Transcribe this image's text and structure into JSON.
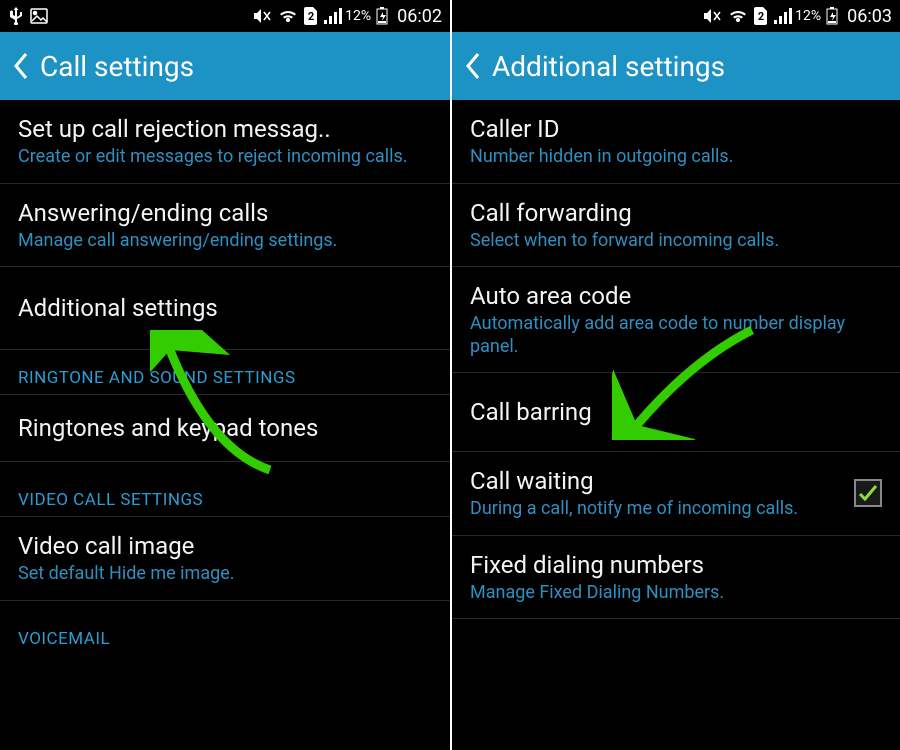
{
  "screens": {
    "left": {
      "status_bar": {
        "battery_pct": "12%",
        "time": "06:02"
      },
      "header_title": "Call settings",
      "items": {
        "reject_msg": {
          "title": "Set up call rejection messag..",
          "sub": "Create or edit messages to reject incoming calls."
        },
        "answering": {
          "title": "Answering/ending calls",
          "sub": "Manage call answering/ending settings."
        },
        "additional": {
          "title": "Additional settings"
        },
        "ringtone_header": "RINGTONE AND SOUND SETTINGS",
        "ringtones": {
          "title": "Ringtones and keypad tones"
        },
        "video_header": "VIDEO CALL SETTINGS",
        "video_image": {
          "title": "Video call image",
          "sub": "Set default Hide me image."
        },
        "voicemail_header": "VOICEMAIL"
      }
    },
    "right": {
      "status_bar": {
        "battery_pct": "12%",
        "time": "06:03"
      },
      "header_title": "Additional settings",
      "items": {
        "caller_id": {
          "title": "Caller ID",
          "sub": "Number hidden in outgoing calls."
        },
        "forwarding": {
          "title": "Call forwarding",
          "sub": "Select when to forward incoming calls."
        },
        "auto_area": {
          "title": "Auto area code",
          "sub": "Automatically add area code to number display panel."
        },
        "barring": {
          "title": "Call barring"
        },
        "waiting": {
          "title": "Call waiting",
          "sub": "During a call, notify me of incoming calls."
        },
        "fixed": {
          "title": "Fixed dialing numbers",
          "sub": "Manage Fixed Dialing Numbers."
        }
      }
    }
  },
  "arrow_color": "#33cc00"
}
